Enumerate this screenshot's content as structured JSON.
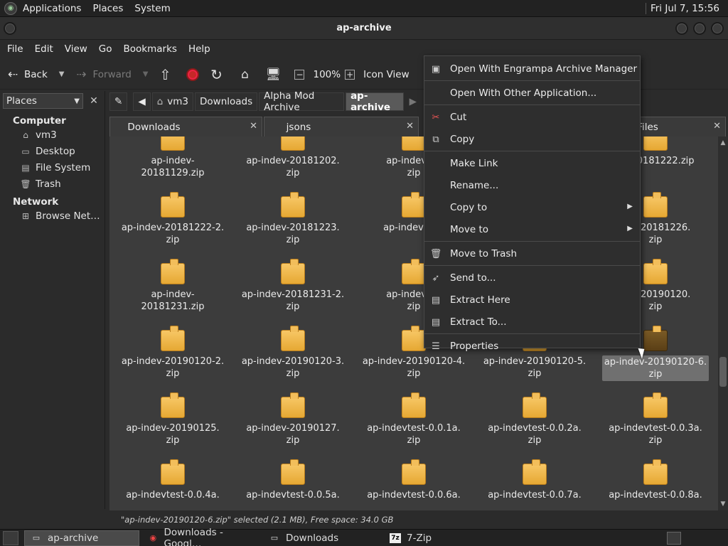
{
  "top_panel": {
    "menus": [
      "Applications",
      "Places",
      "System"
    ],
    "clock": "Fri Jul  7, 15:56"
  },
  "window": {
    "title": "ap-archive"
  },
  "menubar": [
    "File",
    "Edit",
    "View",
    "Go",
    "Bookmarks",
    "Help"
  ],
  "toolbar": {
    "back": "Back",
    "forward": "Forward",
    "zoom": "100%",
    "view_mode": "Icon View"
  },
  "sidebar": {
    "combo": "Places",
    "computer_heading": "Computer",
    "computer_items": [
      "vm3",
      "Desktop",
      "File System",
      "Trash"
    ],
    "network_heading": "Network",
    "network_items": [
      "Browse Net…"
    ]
  },
  "location": {
    "crumbs": [
      "vm3",
      "Downloads",
      "Alpha Mod Archive",
      "ap-archive"
    ]
  },
  "tabs": [
    "Downloads",
    "jsons",
    "Files"
  ],
  "files": [
    [
      "ap-indev-20181129.zip",
      "ap-indev-20181202.",
      "zip"
    ],
    [
      "ap-indev-20",
      "zip"
    ],
    [],
    [],
    [
      "ev-20181222.zip"
    ],
    [
      "ap-indev-20181222-2.",
      "zip"
    ],
    [
      "ap-indev-20181223.",
      "zip"
    ],
    [
      "ap-indev-201"
    ],
    [],
    [
      "dev-20181226.",
      "zip"
    ],
    [
      "ap-indev-20181231.zip"
    ],
    [
      "ap-indev-20181231-2.",
      "zip"
    ],
    [
      "ap-indev-20",
      "zip"
    ],
    [],
    [
      "dev-20190120.",
      "zip"
    ],
    [
      "ap-indev-20190120-2.",
      "zip"
    ],
    [
      "ap-indev-20190120-3.",
      "zip"
    ],
    [
      "ap-indev-20190120-4.",
      "zip"
    ],
    [
      "ap-indev-20190120-5.",
      "zip"
    ],
    [
      "ap-indev-20190120-6.",
      "zip"
    ],
    [
      "ap-indev-20190125.",
      "zip"
    ],
    [
      "ap-indev-20190127.",
      "zip"
    ],
    [
      "ap-indevtest-0.0.1a.",
      "zip"
    ],
    [
      "ap-indevtest-0.0.2a.",
      "zip"
    ],
    [
      "ap-indevtest-0.0.3a.",
      "zip"
    ],
    [
      "ap-indevtest-0.0.4a.",
      "zip"
    ],
    [
      "ap-indevtest-0.0.5a.",
      "zip"
    ],
    [
      "ap-indevtest-0.0.6a.",
      "zip"
    ],
    [
      "ap-indevtest-0.0.7a.",
      "zip"
    ],
    [
      "ap-indevtest-0.0.8a.",
      "zip"
    ]
  ],
  "file_labels": {
    "r0c0": "ap-indev-20181129.zip",
    "r0c1a": "ap-indev-20181202.",
    "r0c1b": "zip",
    "r0c2a": "ap-indev-20",
    "r0c2b": "zip",
    "r0c4": "ev-20181222.zip",
    "r1c0a": "ap-indev-20181222-2.",
    "r1c0b": "zip",
    "r1c1a": "ap-indev-20181223.",
    "r1c1b": "zip",
    "r1c2": "ap-indev-201",
    "r1c4a": "dev-20181226.",
    "r1c4b": "zip",
    "r2c0": "ap-indev-20181231.zip",
    "r2c1a": "ap-indev-20181231-2.",
    "r2c1b": "zip",
    "r2c2a": "ap-indev-20",
    "r2c2b": "zip",
    "r2c4a": "dev-20190120.",
    "r2c4b": "zip",
    "r3c0a": "ap-indev-20190120-2.",
    "r3c0b": "zip",
    "r3c1a": "ap-indev-20190120-3.",
    "r3c1b": "zip",
    "r3c2a": "ap-indev-20190120-4.",
    "r3c2b": "zip",
    "r3c3a": "ap-indev-20190120-5.",
    "r3c3b": "zip",
    "r3c4a": "ap-indev-20190120-6.",
    "r3c4b": "zip",
    "r4c0a": "ap-indev-20190125.",
    "r4c0b": "zip",
    "r4c1a": "ap-indev-20190127.",
    "r4c1b": "zip",
    "r4c2a": "ap-indevtest-0.0.1a.",
    "r4c2b": "zip",
    "r4c3a": "ap-indevtest-0.0.2a.",
    "r4c3b": "zip",
    "r4c4a": "ap-indevtest-0.0.3a.",
    "r4c4b": "zip",
    "r5c0": "ap-indevtest-0.0.4a.",
    "r5c1": "ap-indevtest-0.0.5a.",
    "r5c2": "ap-indevtest-0.0.6a.",
    "r5c3": "ap-indevtest-0.0.7a.",
    "r5c4": "ap-indevtest-0.0.8a."
  },
  "status": "\"ap-indev-20190120-6.zip\" selected (2.1 MB), Free space: 34.0 GB",
  "context_menu": {
    "open_with_engrampa": "Open With Engrampa Archive Manager",
    "open_with_other": "Open With Other Application...",
    "cut": "Cut",
    "copy": "Copy",
    "make_link": "Make Link",
    "rename": "Rename...",
    "copy_to": "Copy to",
    "move_to": "Move to",
    "move_to_trash": "Move to Trash",
    "send_to": "Send to...",
    "extract_here": "Extract Here",
    "extract_to": "Extract To...",
    "properties": "Properties"
  },
  "taskbar": [
    "ap-archive",
    "Downloads - Googl…",
    "Downloads",
    "7-Zip"
  ],
  "taskbar_icon_7zip": "7z"
}
